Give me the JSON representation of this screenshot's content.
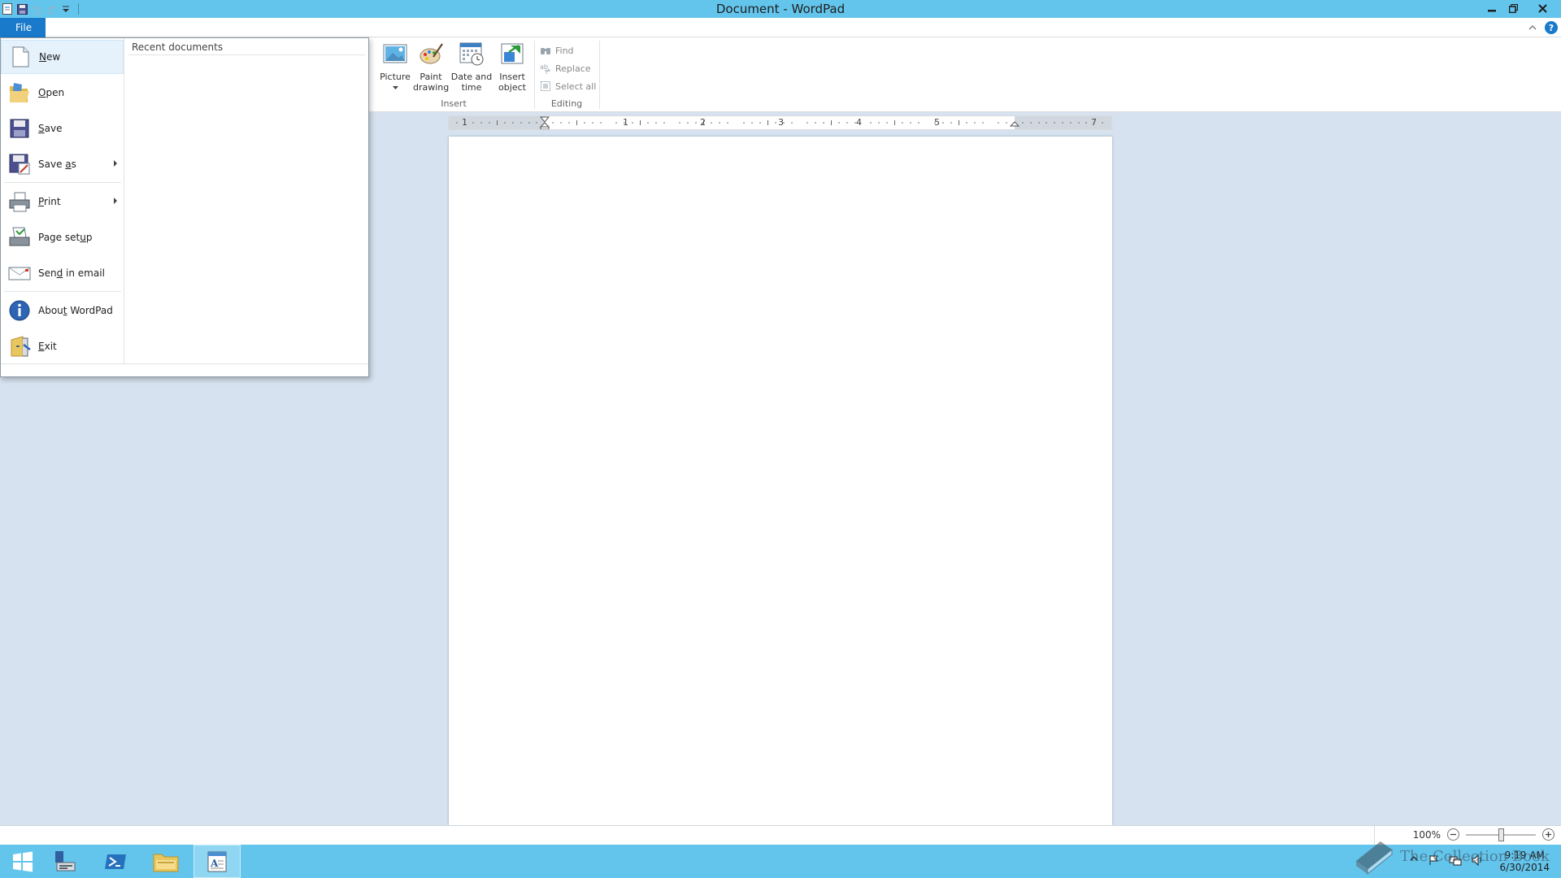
{
  "window": {
    "title": "Document - WordPad"
  },
  "ribbon": {
    "file_tab": "File",
    "insert_group": {
      "label": "Insert",
      "picture": "Picture",
      "paint_drawing_1": "Paint",
      "paint_drawing_2": "drawing",
      "date_time_1": "Date and",
      "date_time_2": "time",
      "insert_object_1": "Insert",
      "insert_object_2": "object"
    },
    "editing_group": {
      "label": "Editing",
      "find": "Find",
      "replace": "Replace",
      "select_all": "Select all"
    }
  },
  "file_menu": {
    "items": [
      {
        "pre": "",
        "key": "N",
        "post": "ew"
      },
      {
        "pre": "",
        "key": "O",
        "post": "pen"
      },
      {
        "pre": "",
        "key": "S",
        "post": "ave"
      },
      {
        "pre": "Save ",
        "key": "a",
        "post": "s"
      },
      {
        "pre": "",
        "key": "P",
        "post": "rint"
      },
      {
        "pre": "Page set",
        "key": "u",
        "post": "p"
      },
      {
        "pre": "Sen",
        "key": "d",
        "post": " in email"
      },
      {
        "pre": "Abou",
        "key": "t",
        "post": " WordPad"
      },
      {
        "pre": "",
        "key": "E",
        "post": "xit"
      }
    ],
    "recent_title": "Recent documents"
  },
  "ruler": {
    "numbers": [
      "1",
      "1",
      "2",
      "3",
      "4",
      "5",
      "7"
    ]
  },
  "status": {
    "zoom": "100%"
  },
  "taskbar": {
    "time": "9:19 AM",
    "date": "6/30/2014"
  },
  "watermark": "The Collection Book",
  "colors": {
    "titlebar": "#64c5ec",
    "file_tab": "#1979ca",
    "workspace": "#d6e2ef"
  }
}
